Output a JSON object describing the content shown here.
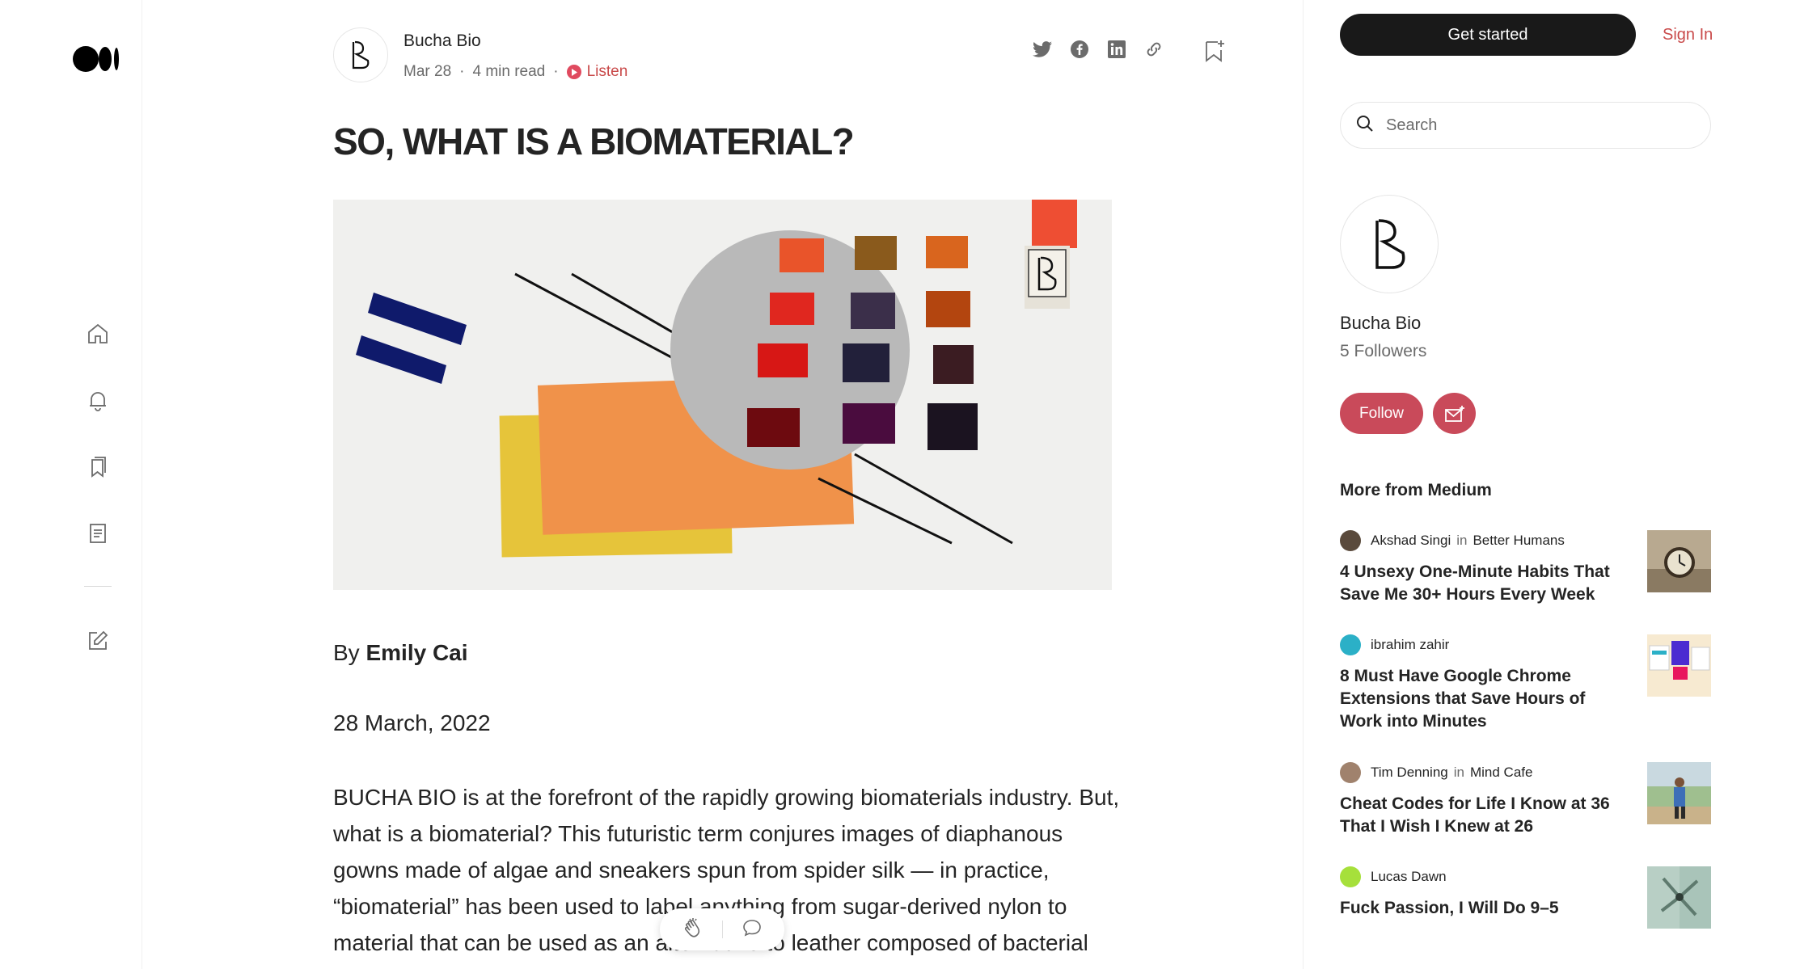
{
  "nav": {
    "logo": "medium-logo",
    "items": [
      "home-icon",
      "bell-icon",
      "bookmarks-icon",
      "stories-icon",
      "write-icon"
    ]
  },
  "article": {
    "author_name": "Bucha Bio",
    "date": "Mar 28",
    "read_time": "4 min read",
    "listen_label": "Listen",
    "title": "SO, WHAT IS A BIOMATERIAL?",
    "byline_prefix": "By",
    "byline_name": "Emily Cai",
    "date_line": "28 March, 2022",
    "body": "BUCHA BIO is at the forefront of the rapidly growing biomaterials industry. But, what is a biomaterial? This futuristic term conjures images of diaphanous gowns made of algae and sneakers spun from spider silk — in practice, “biomaterial” has been used to label anything from sugar-derived nylon to material that can be used as an alternative to leather composed of bacterial cellulose. While “biomaterial” can be a catch-all word in practice"
  },
  "sidebar": {
    "get_started": "Get started",
    "sign_in": "Sign In",
    "search_placeholder": "Search",
    "profile_name": "Bucha Bio",
    "followers": "5 Followers",
    "follow_label": "Follow",
    "more_title": "More from Medium",
    "stories": [
      {
        "author": "Akshad Singi",
        "in": "in",
        "publication": "Better Humans",
        "title": "4 Unsexy One-Minute Habits That Save Me 30+ Hours Every Week"
      },
      {
        "author": "ibrahim zahir",
        "in": "",
        "publication": "",
        "title": "8 Must Have Google Chrome Extensions that Save Hours of Work into Minutes"
      },
      {
        "author": "Tim Denning",
        "in": "in",
        "publication": "Mind Cafe",
        "title": "Cheat Codes for Life I Know at 36 That I Wish I Knew at 26"
      },
      {
        "author": "Lucas Dawn",
        "in": "",
        "publication": "",
        "title": "Fuck Passion, I Will Do 9–5"
      }
    ]
  },
  "colors": {
    "accent": "#c94a5a",
    "listen": "#e04a5f",
    "text": "#242424",
    "muted": "#6b6b6b"
  }
}
